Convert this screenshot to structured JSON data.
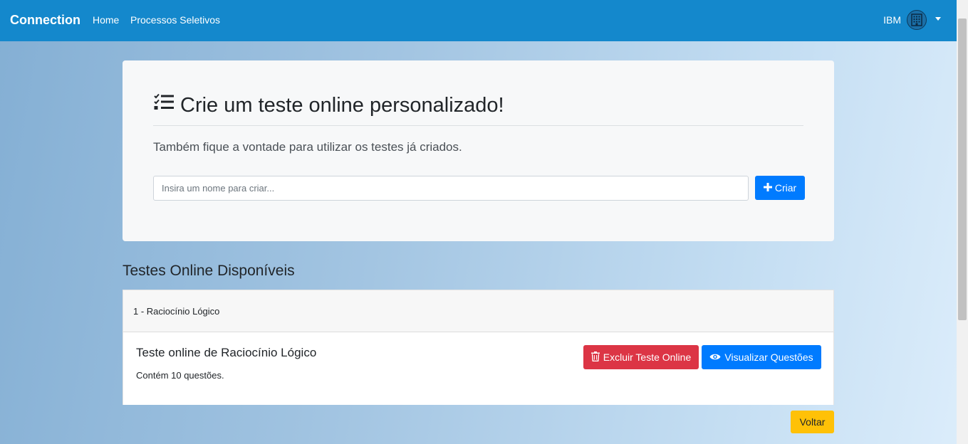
{
  "navbar": {
    "brand": "Connection",
    "links": [
      "Home",
      "Processos Seletivos"
    ],
    "user": "IBM"
  },
  "jumbotron": {
    "title": "Crie um teste online personalizado!",
    "lead": "Também fique a vontade para utilizar os testes já criados.",
    "input_placeholder": "Insira um nome para criar...",
    "create_label": "Criar"
  },
  "section": {
    "title": "Testes Online Disponíveis"
  },
  "card": {
    "header": "1 - Raciocínio Lógico",
    "title": "Teste online de Raciocínio Lógico",
    "text": "Contém 10 questões.",
    "delete_label": "Excluir Teste Online",
    "view_label": "Visualizar Questões"
  },
  "back_label": "Voltar",
  "colors": {
    "navbar": "#1488cc",
    "primary": "#007bff",
    "danger": "#dc3545",
    "warning": "#ffc107"
  }
}
